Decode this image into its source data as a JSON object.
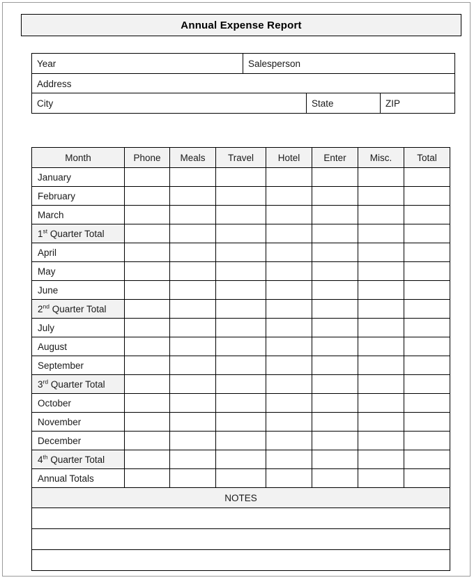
{
  "document": {
    "title": "Annual Expense Report"
  },
  "info": {
    "year_label": "Year",
    "year_value": "",
    "salesperson_label": "Salesperson",
    "salesperson_value": "",
    "address_label": "Address",
    "address_value": "",
    "city_label": "City",
    "city_value": "",
    "state_label": "State",
    "state_value": "",
    "zip_label": "ZIP",
    "zip_value": ""
  },
  "expense_table": {
    "columns": [
      "Month",
      "Phone",
      "Meals",
      "Travel",
      "Hotel",
      "Enter",
      "Misc.",
      "Total"
    ],
    "rows": [
      {
        "label": "January",
        "sup": "",
        "type": "month",
        "values": [
          "",
          "",
          "",
          "",
          "",
          "",
          ""
        ]
      },
      {
        "label": "February",
        "sup": "",
        "type": "month",
        "values": [
          "",
          "",
          "",
          "",
          "",
          "",
          ""
        ]
      },
      {
        "label": "March",
        "sup": "",
        "type": "month",
        "values": [
          "",
          "",
          "",
          "",
          "",
          "",
          ""
        ]
      },
      {
        "label": "1",
        "sup": "st",
        "suffix": " Quarter Total",
        "type": "quarter",
        "values": [
          "",
          "",
          "",
          "",
          "",
          "",
          ""
        ]
      },
      {
        "label": "April",
        "sup": "",
        "type": "month",
        "values": [
          "",
          "",
          "",
          "",
          "",
          "",
          ""
        ]
      },
      {
        "label": "May",
        "sup": "",
        "type": "month",
        "values": [
          "",
          "",
          "",
          "",
          "",
          "",
          ""
        ]
      },
      {
        "label": "June",
        "sup": "",
        "type": "month",
        "values": [
          "",
          "",
          "",
          "",
          "",
          "",
          ""
        ]
      },
      {
        "label": "2",
        "sup": "nd",
        "suffix": " Quarter Total",
        "type": "quarter",
        "values": [
          "",
          "",
          "",
          "",
          "",
          "",
          ""
        ]
      },
      {
        "label": "July",
        "sup": "",
        "type": "month",
        "values": [
          "",
          "",
          "",
          "",
          "",
          "",
          ""
        ]
      },
      {
        "label": "August",
        "sup": "",
        "type": "month",
        "values": [
          "",
          "",
          "",
          "",
          "",
          "",
          ""
        ]
      },
      {
        "label": "September",
        "sup": "",
        "type": "month",
        "values": [
          "",
          "",
          "",
          "",
          "",
          "",
          ""
        ]
      },
      {
        "label": "3",
        "sup": "rd",
        "suffix": " Quarter Total",
        "type": "quarter",
        "values": [
          "",
          "",
          "",
          "",
          "",
          "",
          ""
        ]
      },
      {
        "label": "October",
        "sup": "",
        "type": "month",
        "values": [
          "",
          "",
          "",
          "",
          "",
          "",
          ""
        ]
      },
      {
        "label": "November",
        "sup": "",
        "type": "month",
        "values": [
          "",
          "",
          "",
          "",
          "",
          "",
          ""
        ]
      },
      {
        "label": "December",
        "sup": "",
        "type": "month",
        "values": [
          "",
          "",
          "",
          "",
          "",
          "",
          ""
        ]
      },
      {
        "label": "4",
        "sup": "th",
        "suffix": " Quarter Total",
        "type": "quarter",
        "values": [
          "",
          "",
          "",
          "",
          "",
          "",
          ""
        ]
      },
      {
        "label": "Annual Totals",
        "sup": "",
        "type": "annual",
        "values": [
          "",
          "",
          "",
          "",
          "",
          "",
          ""
        ]
      }
    ]
  },
  "notes": {
    "heading": "NOTES",
    "lines": [
      "",
      "",
      ""
    ]
  },
  "colors": {
    "shade": "#f2f2f2",
    "border": "#000000",
    "page_border": "#9a9a9a",
    "text": "#1a1a1a",
    "background": "#ffffff"
  }
}
